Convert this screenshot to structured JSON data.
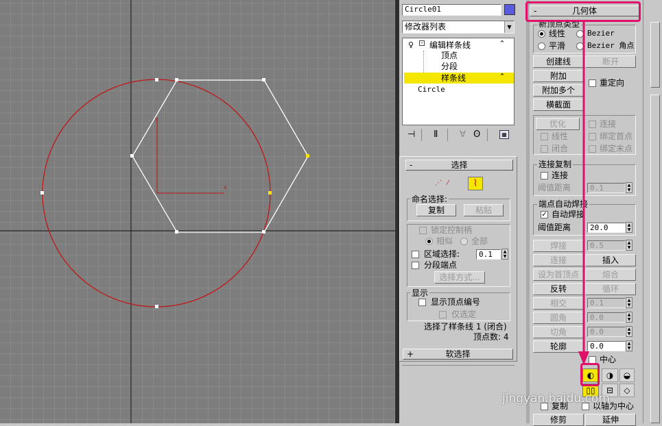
{
  "object_name": "Circle01",
  "object_color": "#5a5adc",
  "modifier_list": "修改器列表",
  "stack": {
    "items": [
      "编辑样条线",
      "顶点",
      "分段",
      "样条线",
      "Circle"
    ],
    "selected_color": "#f5e600"
  },
  "select_rollout": {
    "title": "选择",
    "sign": "-",
    "named_selection": "命名选择:",
    "copy": "复制",
    "paste": "粘贴",
    "lock_handles": "锁定控制柄",
    "similar": "相似",
    "all": "全部",
    "area_select": "区域选择:",
    "area_value": "0.1",
    "segment_end": "分段端点",
    "select_by": "选择方式...",
    "display": "显示",
    "show_vertex_numbers": "显示顶点编号",
    "selected_only": "仅选定",
    "status_line": "选择了样条线 1 (闭合)",
    "vertex_count": "顶点数: 4"
  },
  "soft_select": {
    "title": "软选择",
    "sign": "+"
  },
  "geometry": {
    "title": "几何体",
    "sign": "-",
    "new_vertex_type": "新顶点类型",
    "linear": "线性",
    "bezier": "Bezier",
    "smooth": "平滑",
    "bezier_corner": "Bezier 角点",
    "create_line": "创建线",
    "break": "断开",
    "attach": "附加",
    "reorient": "重定向",
    "attach_multiple": "附加多个",
    "cross_section": "横截面",
    "refine": "优化",
    "connect": "连接",
    "linear2": "线性",
    "bind_first": "绑定首点",
    "closed": "闭合",
    "bind_last": "绑定末点",
    "connect_copy": "连接复制",
    "connect2": "连接",
    "threshold": "阈值距离",
    "threshold_value": "0.1",
    "endpoint_weld": "端点自动焊接",
    "auto_weld": "自动焊接",
    "threshold2": "阈值距离",
    "threshold2_value": "20.0",
    "weld": "焊接",
    "weld_value": "0.5",
    "connect3": "连接",
    "insert": "插入",
    "make_first": "设为首顶点",
    "fuse": "熔合",
    "reverse": "反转",
    "cycle": "循环",
    "intersect": "相交",
    "intersect_value": "0.1",
    "fillet": "圆角",
    "fillet_value": "0.0",
    "chamfer": "切角",
    "chamfer_value": "0.0",
    "outline": "轮廓",
    "outline_value": "0.0",
    "center": "中心",
    "copy": "复制",
    "about_pivot": "以轴为中心",
    "trim": "修剪",
    "extend": "延伸"
  },
  "watermark": "jingyan.baidu.com",
  "annotation_color": "#e0106a",
  "colors": {
    "circle": "#c01818",
    "hexagon": "#ffffff",
    "vertex_selected": "#f5e600"
  }
}
